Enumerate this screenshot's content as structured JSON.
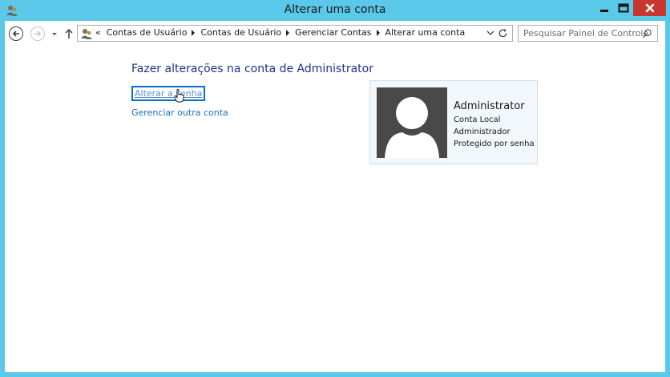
{
  "window": {
    "title": "Alterar uma conta",
    "accent_color": "#5ac8e8",
    "close_color": "#c7372f"
  },
  "navigation": {
    "back_icon": "back-arrow-icon",
    "forward_icon": "forward-arrow-icon",
    "recent_icon": "chevron-down-icon",
    "up_icon": "up-arrow-icon"
  },
  "address_bar": {
    "overflow": "«",
    "breadcrumbs": [
      "Contas de Usuário",
      "Contas de Usuário",
      "Gerenciar Contas",
      "Alterar uma conta"
    ]
  },
  "search": {
    "placeholder": "Pesquisar Painel de Controle"
  },
  "main": {
    "heading": "Fazer alterações na conta de Administrator",
    "links": {
      "change_password": "Alterar a senha",
      "manage_other": "Gerenciar outra conta"
    }
  },
  "account": {
    "name": "Administrator",
    "type": "Conta Local",
    "role": "Administrador",
    "status": "Protegido por senha"
  }
}
